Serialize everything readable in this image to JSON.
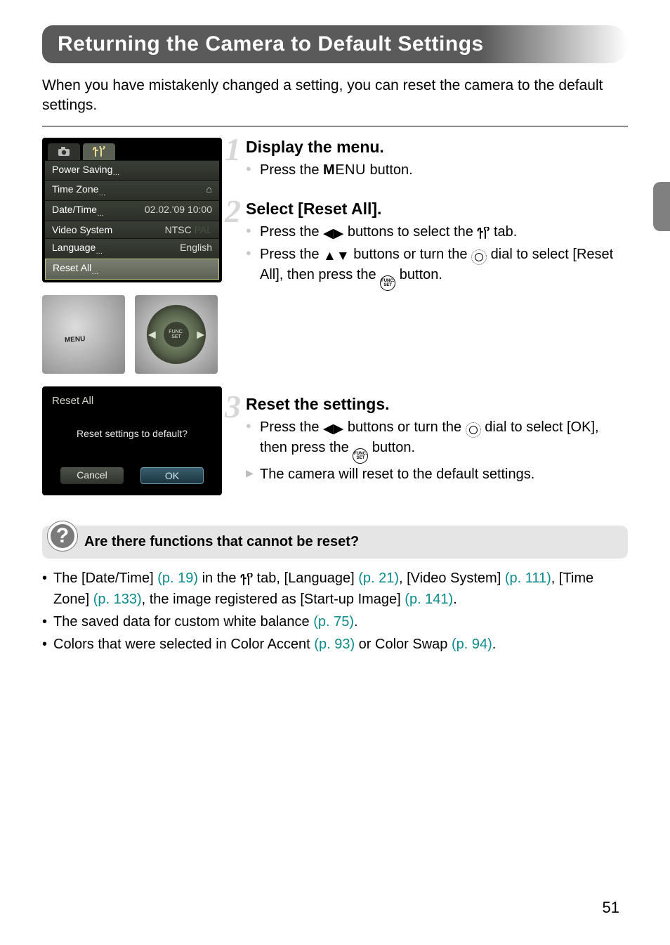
{
  "title": "Returning the Camera to Default Settings",
  "intro": "When you have mistakenly changed a setting, you can reset the camera to the default settings.",
  "lcd1": {
    "tabCameraIcon": "camera-icon",
    "tabToolsIcon": "tools-icon",
    "rows": [
      {
        "label": "Power Saving",
        "value": "",
        "ellips": true
      },
      {
        "label": "Time Zone",
        "value": "home-icon",
        "ellips": true
      },
      {
        "label": "Date/Time",
        "value": "02.02.'09 10:00",
        "ellips": true
      },
      {
        "label": "Video System",
        "value": "NTSC",
        "dim": "PAL"
      },
      {
        "label": "Language",
        "value": "English",
        "ellips": true
      },
      {
        "label": "Reset All",
        "value": "",
        "ellips": true,
        "selected": true
      }
    ]
  },
  "photoMenuLabel": "MENU",
  "wheelCenter": {
    "line1": "FUNC.",
    "line2": "SET"
  },
  "lcd2": {
    "title": "Reset All",
    "question": "Reset settings to default?",
    "cancel": "Cancel",
    "ok": "OK"
  },
  "steps": [
    {
      "num": "1",
      "heading": "Display the menu.",
      "lines": [
        {
          "type": "dot",
          "segments": [
            "Press the ",
            {
              "t": "menuword"
            },
            " button."
          ]
        }
      ]
    },
    {
      "num": "2",
      "heading": "Select [Reset All].",
      "lines": [
        {
          "type": "dot",
          "segments": [
            "Press the ",
            {
              "t": "lr"
            },
            " buttons to select the ",
            {
              "t": "tools"
            },
            " tab."
          ]
        },
        {
          "type": "dot",
          "segments": [
            "Press the ",
            {
              "t": "ud"
            },
            " buttons or turn the ",
            {
              "t": "dial"
            },
            " dial to select [Reset All], then press the ",
            {
              "t": "funcset"
            },
            " button."
          ]
        }
      ]
    },
    {
      "num": "3",
      "heading": "Reset the settings.",
      "lines": [
        {
          "type": "dot",
          "segments": [
            "Press the ",
            {
              "t": "lr"
            },
            " buttons or turn the ",
            {
              "t": "dial"
            },
            " dial to select [OK], then press the ",
            {
              "t": "funcset"
            },
            " button."
          ]
        },
        {
          "type": "tri",
          "segments": [
            "The camera will reset to the default settings."
          ]
        }
      ]
    }
  ],
  "qbox": {
    "heading": "Are there functions that cannot be reset?",
    "items": [
      [
        "The [Date/Time] ",
        {
          "pg": "(p. 19)"
        },
        " in the ",
        {
          "t": "tools"
        },
        " tab, [Language] ",
        {
          "pg": "(p. 21)"
        },
        ", [Video System] ",
        {
          "pg": "(p. 111)"
        },
        ", [Time Zone] ",
        {
          "pg": "(p. 133)"
        },
        ", the image registered as [Start-up Image] ",
        {
          "pg": "(p. 141)"
        },
        "."
      ],
      [
        "The saved data for custom white balance ",
        {
          "pg": "(p. 75)"
        },
        "."
      ],
      [
        "Colors that were selected in Color Accent ",
        {
          "pg": "(p. 93)"
        },
        " or Color Swap ",
        {
          "pg": "(p. 94)"
        },
        "."
      ]
    ]
  },
  "pageNumber": "51"
}
